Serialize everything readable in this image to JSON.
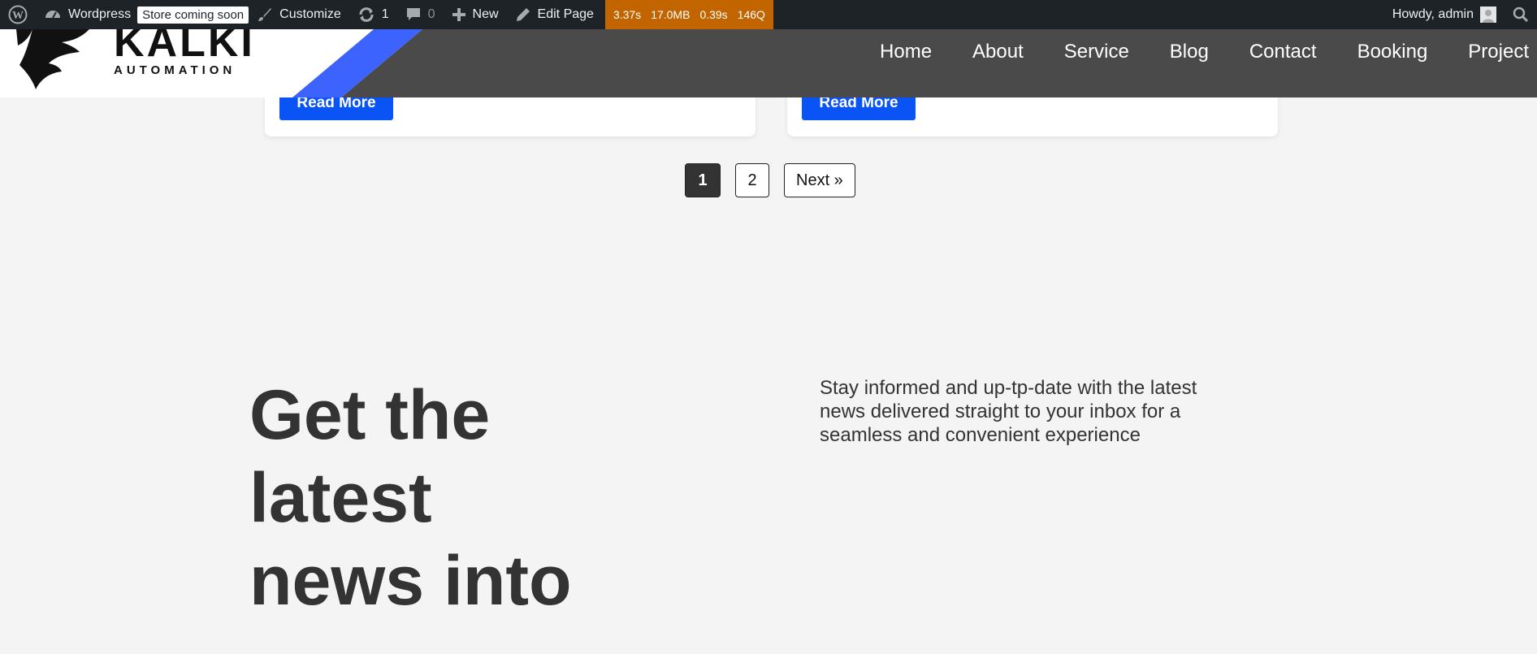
{
  "adminbar": {
    "site_name": "Wordpress",
    "store_badge": "Store coming soon",
    "customize": "Customize",
    "updates_count": "1",
    "comments_count": "0",
    "new": "New",
    "edit_page": "Edit Page",
    "perf": [
      "3.37s",
      "17.0MB",
      "0.39s",
      "146Q"
    ],
    "greeting": "Howdy, admin"
  },
  "header": {
    "logo_title": "KALKI",
    "logo_subtitle": "AUTOMATION",
    "nav": [
      "Home",
      "About",
      "Service",
      "Blog",
      "Contact",
      "Booking",
      "Project"
    ]
  },
  "cards": {
    "read_more_label": "Read More"
  },
  "pagination": {
    "pages": [
      "1",
      "2"
    ],
    "current": "1",
    "next": "Next »"
  },
  "newsletter": {
    "headline": "Get the latest news into",
    "subtext": "Stay informed and up-tp-date with the latest news delivered straight to your inbox for a seamless and convenient experience"
  },
  "colors": {
    "adminbar_bg": "#1d2327",
    "perf_bg": "#c26500",
    "accent_blue": "#0a53f5",
    "stripe_blue": "#3d63ff",
    "header_bg": "#4a4a4a",
    "page_bg": "#f4f4f4"
  },
  "icons": [
    "wordpress-icon",
    "dashboard-icon",
    "brush-icon",
    "refresh-icon",
    "comment-icon",
    "plus-icon",
    "pencil-icon",
    "user-icon",
    "search-icon"
  ]
}
